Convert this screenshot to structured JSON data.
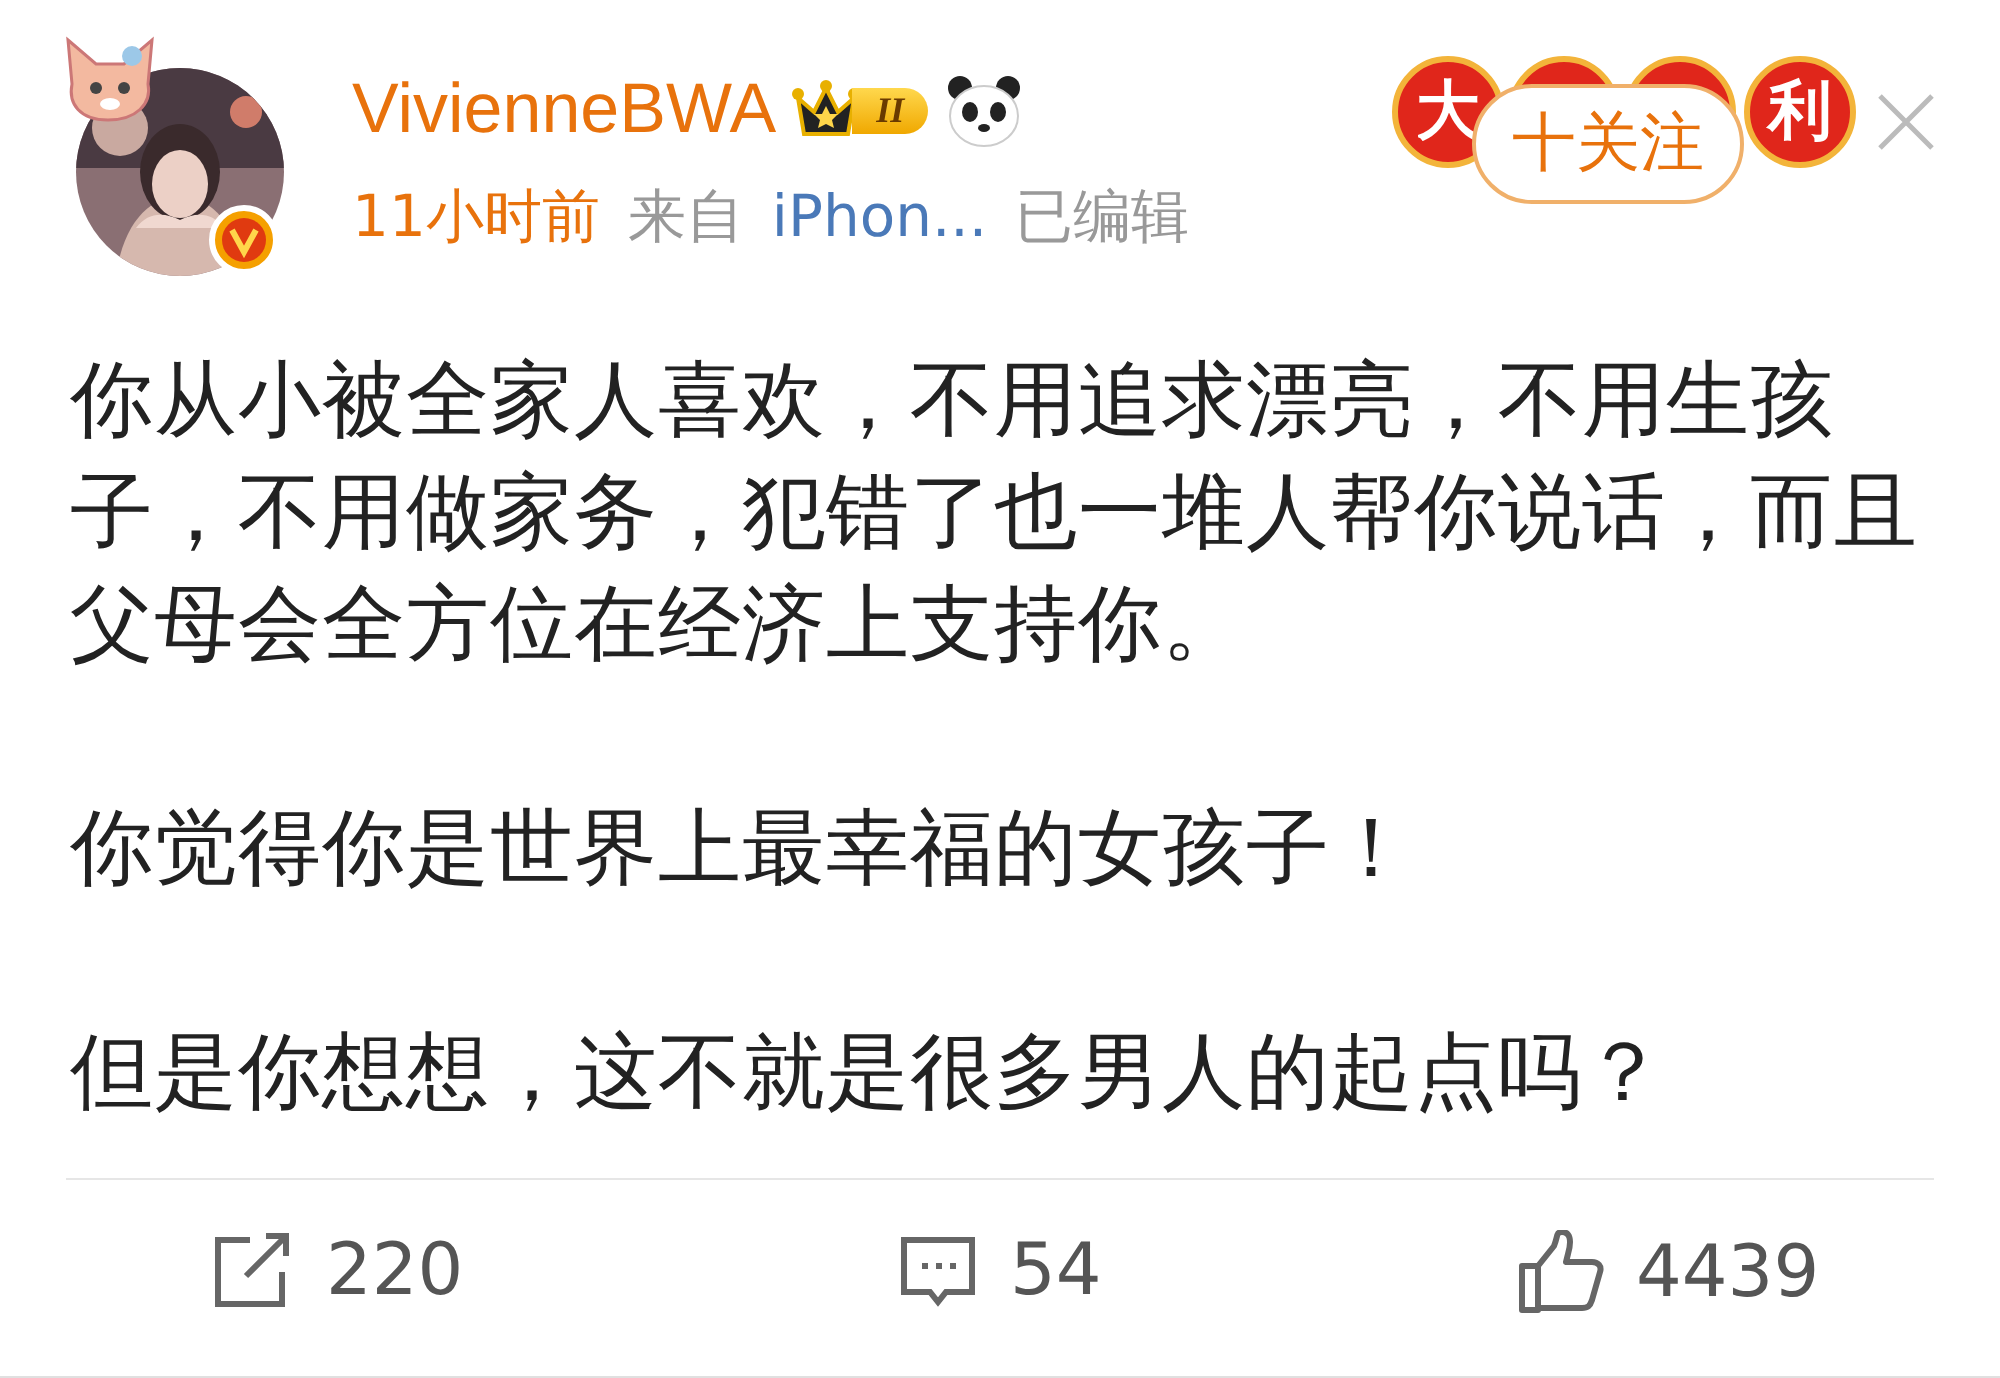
{
  "post": {
    "author": "VivienneBWA",
    "level_badge": "II",
    "time": "11小时前",
    "source_prefix": "来自",
    "source": "iPhon...",
    "edited": "已编辑",
    "banner": [
      "大",
      "利"
    ],
    "follow_button": "十关注",
    "paragraphs": [
      "你从小被全家人喜欢，不用追求漂亮，不用生孩子，不用做家务，犯错了也一堆人帮你说话，而且父母会全方位在经济上支持你。",
      "你觉得你是世界上最幸福的女孩子！",
      "但是你想想，这不就是很多男人的起点吗？"
    ]
  },
  "actions": [
    {
      "kind": "repost",
      "count": "220"
    },
    {
      "kind": "comment",
      "count": "54"
    },
    {
      "kind": "like",
      "count": "4439"
    }
  ]
}
